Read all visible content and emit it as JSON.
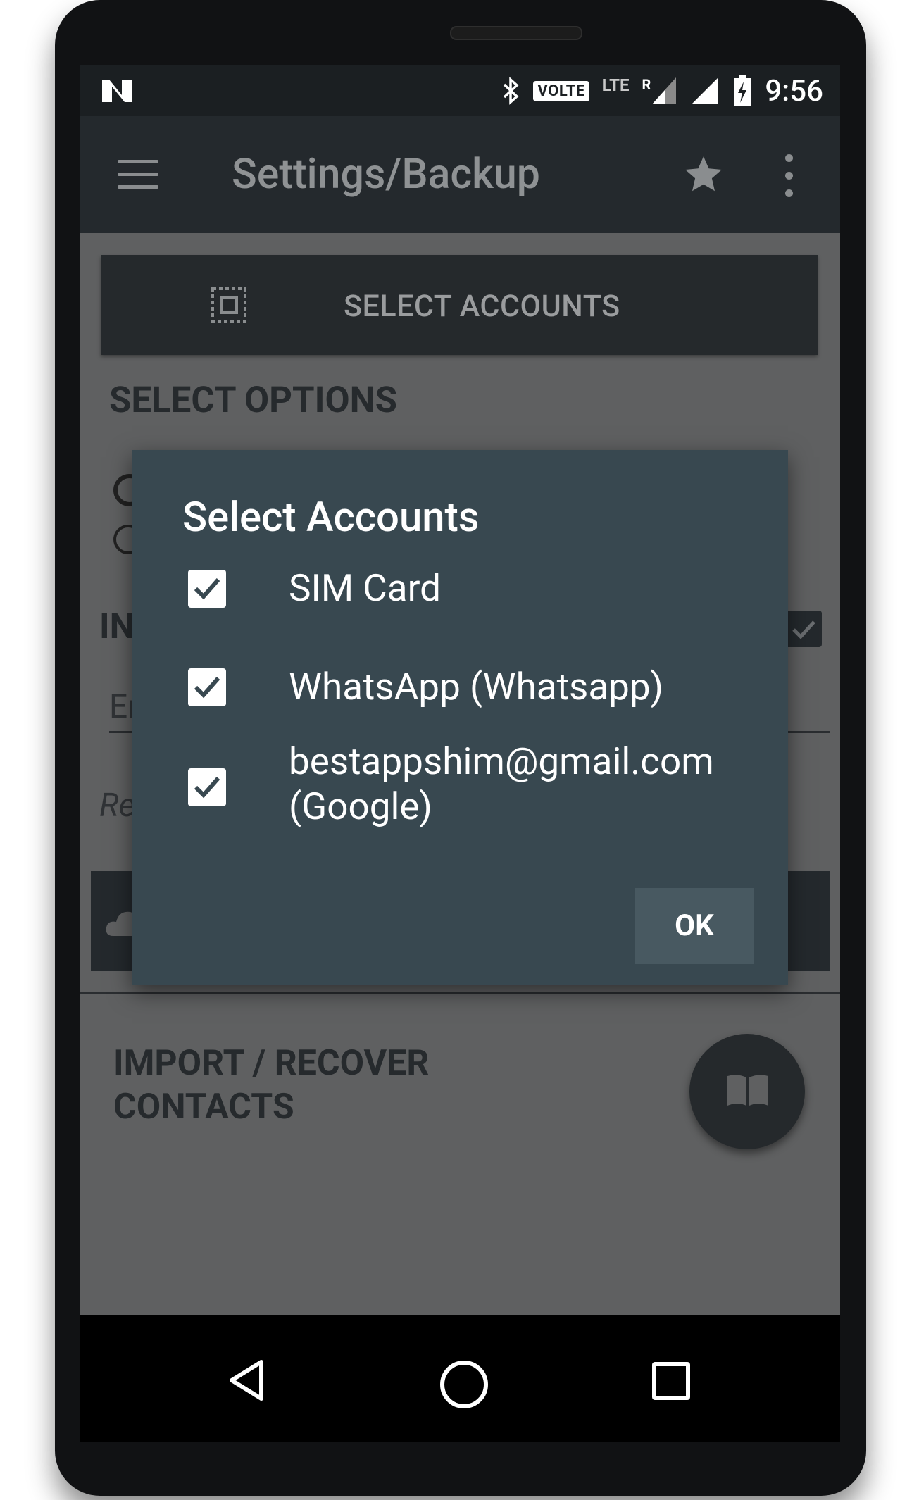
{
  "status_bar": {
    "volte": "VOLTE",
    "lte": "LTE",
    "roaming": "R",
    "time": "9:56"
  },
  "app_bar": {
    "title": "Settings/Backup"
  },
  "main": {
    "select_accounts_button": "SELECT ACCOUNTS",
    "select_options_heading": "SELECT OPTIONS",
    "partial_in": "IN",
    "partial_email": "Er",
    "partial_re": "Re",
    "import_title_line1": "IMPORT / RECOVER",
    "import_title_line2": "CONTACTS"
  },
  "dialog": {
    "title": "Select Accounts",
    "options": [
      {
        "label": "SIM Card",
        "checked": true
      },
      {
        "label": "WhatsApp (Whatsapp)",
        "checked": true
      },
      {
        "label_line1": "bestappshim@gmail.com",
        "label_line2": "(Google)",
        "checked": true
      }
    ],
    "ok_label": "OK"
  },
  "icons": {
    "notification": "n-logo-icon",
    "bluetooth": "bluetooth-icon",
    "signal": "signal-icon",
    "battery": "battery-charging-icon",
    "menu": "hamburger-menu-icon",
    "star": "star-icon",
    "overflow": "more-vert-icon",
    "select": "select-all-icon",
    "book": "book-icon",
    "back": "nav-back-icon",
    "home": "nav-home-icon",
    "recents": "nav-recents-icon"
  },
  "colors": {
    "appbar": "#24292d",
    "dialog": "#384850",
    "overlay": "#5f6061",
    "ok_button": "#485961"
  }
}
